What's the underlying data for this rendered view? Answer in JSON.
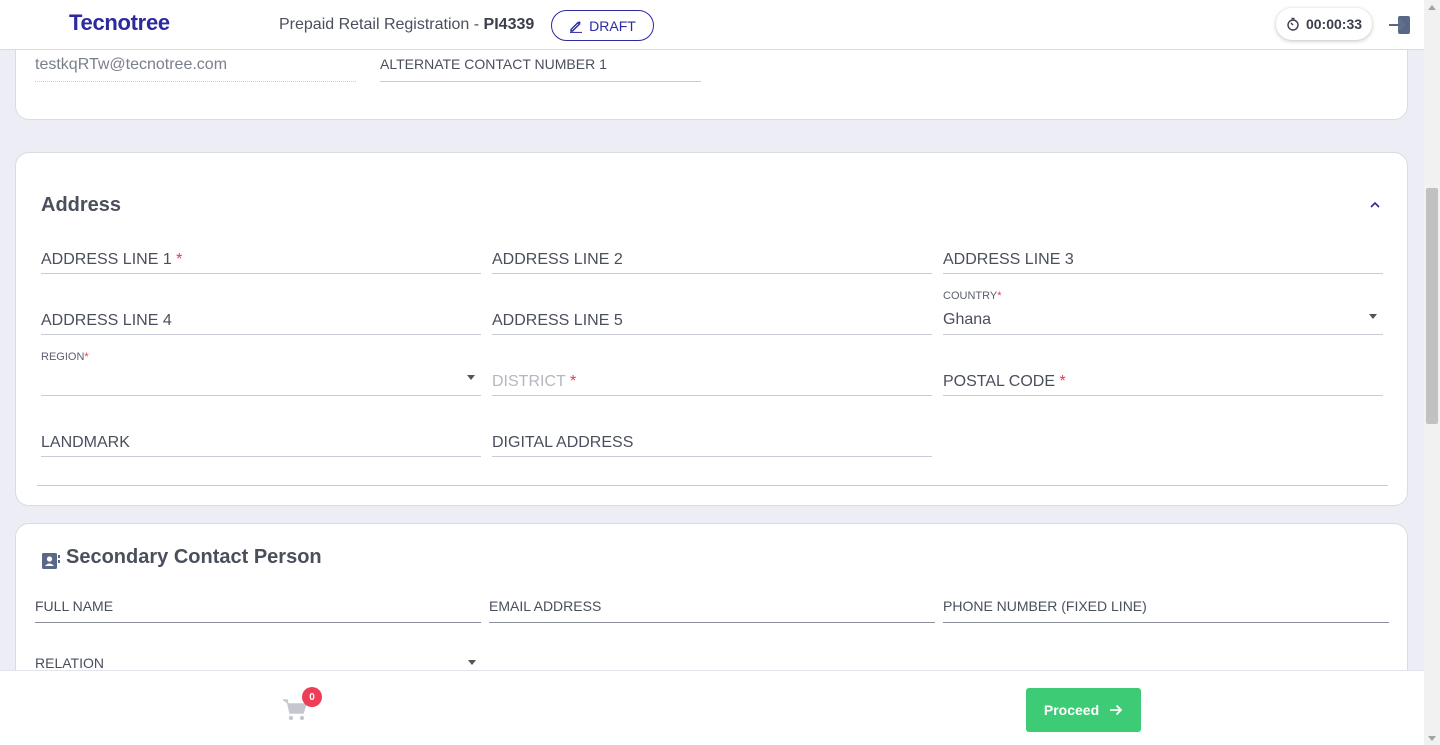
{
  "header": {
    "logo": "Tecnotree",
    "title_prefix": "Prepaid Retail Registration - ",
    "title_id": "PI4339",
    "draft_label": "DRAFT",
    "timer": "00:00:33"
  },
  "contact_card": {
    "email_value": "testkqRTw@tecnotree.com",
    "alt_contact_label": "ALTERNATE CONTACT NUMBER 1"
  },
  "address": {
    "title": "Address",
    "address_line_1": "ADDRESS LINE 1",
    "address_line_2": "ADDRESS LINE 2",
    "address_line_3": "ADDRESS LINE 3",
    "address_line_4": "ADDRESS LINE 4",
    "address_line_5": "ADDRESS LINE 5",
    "country_label": "COUNTRY",
    "country_value": "Ghana",
    "region_label": "REGION",
    "district_label": "DISTRICT",
    "postal_code_label": "POSTAL CODE",
    "landmark_label": "LANDMARK",
    "digital_address_label": "DIGITAL ADDRESS",
    "required_mark": "*"
  },
  "secondary_contact": {
    "title": "Secondary Contact Person",
    "full_name_label": "FULL NAME",
    "email_label": "EMAIL ADDRESS",
    "phone_label": "PHONE NUMBER (FIXED LINE)",
    "relation_label": "RELATION"
  },
  "footer": {
    "cart_count": "0",
    "proceed_label": "Proceed"
  },
  "colors": {
    "brand": "#2c2a9e",
    "required": "#e53950",
    "proceed": "#3dcb75",
    "badge": "#ee3e57"
  }
}
